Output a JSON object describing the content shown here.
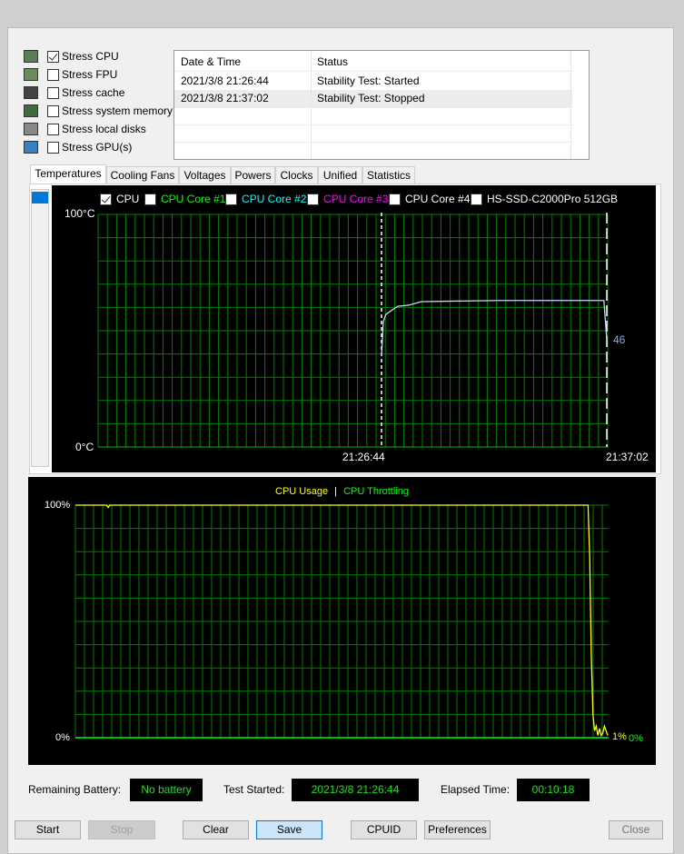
{
  "stress_options": [
    {
      "label": "Stress CPU",
      "checked": true,
      "icon": "cpu-chip-icon"
    },
    {
      "label": "Stress FPU",
      "checked": false,
      "icon": "fpu-percent-icon"
    },
    {
      "label": "Stress cache",
      "checked": false,
      "icon": "cache-chip-icon"
    },
    {
      "label": "Stress system memory",
      "checked": false,
      "icon": "memory-module-icon"
    },
    {
      "label": "Stress local disks",
      "checked": false,
      "icon": "disk-drive-icon"
    },
    {
      "label": "Stress GPU(s)",
      "checked": false,
      "icon": "gpu-monitor-icon"
    }
  ],
  "log": {
    "headers": [
      "Date & Time",
      "Status"
    ],
    "rows": [
      [
        "2021/3/8 21:26:44",
        "Stability Test: Started"
      ],
      [
        "2021/3/8 21:37:02",
        "Stability Test: Stopped"
      ]
    ]
  },
  "tabs": [
    "Temperatures",
    "Cooling Fans",
    "Voltages",
    "Powers",
    "Clocks",
    "Unified",
    "Statistics"
  ],
  "selected_tab": "Temperatures",
  "temp_chart": {
    "legend": [
      {
        "label": "CPU",
        "checked": true,
        "color": "#ffffff"
      },
      {
        "label": "CPU Core #1",
        "checked": false,
        "color": "#00ff00"
      },
      {
        "label": "CPU Core #2",
        "checked": false,
        "color": "#00ffff"
      },
      {
        "label": "CPU Core #3",
        "checked": false,
        "color": "#ff00ff"
      },
      {
        "label": "CPU Core #4",
        "checked": false,
        "color": "#ffffff"
      },
      {
        "label": "HS-SSD-C2000Pro 512GB",
        "checked": false,
        "color": "#ffffff"
      }
    ],
    "y_max_label": "100°C",
    "y_min_label": "0°C",
    "x_labels": [
      "21:26:44",
      "21:37:02"
    ],
    "current_value": "46"
  },
  "usage_chart": {
    "legend": [
      {
        "label": "CPU Usage",
        "color": "#ffff00"
      },
      {
        "label": "CPU Throttling",
        "color": "#00ff00"
      }
    ],
    "separator": "|",
    "y_max_label": "100%",
    "y_min_label": "0%",
    "usage_value": "1%",
    "throttling_value": "0%"
  },
  "chart_data": [
    {
      "type": "line",
      "title": "",
      "ylabel": "",
      "ylim": [
        0,
        100
      ],
      "grid": true,
      "series": [
        {
          "name": "CPU",
          "color": "#c8d8ff",
          "points": [
            [
              "21:26:44",
              39
            ],
            [
              "21:26:49",
              54
            ],
            [
              "21:26:56",
              57
            ],
            [
              "21:27:14",
              59
            ],
            [
              "21:27:29",
              60.5
            ],
            [
              "21:27:59",
              61
            ],
            [
              "21:28:34",
              62.5
            ],
            [
              "21:32:08",
              63
            ],
            [
              "21:36:54",
              63
            ],
            [
              "21:37:02",
              46
            ]
          ]
        }
      ],
      "markers": [
        "21:26:44",
        "21:37:02"
      ]
    },
    {
      "type": "line",
      "title": "",
      "ylim": [
        0,
        100
      ],
      "grid": true,
      "series": [
        {
          "name": "CPU Usage",
          "color": "#ffff00",
          "values": [
            100,
            100,
            100,
            100,
            100,
            100,
            100,
            100,
            100,
            100,
            100,
            100,
            100,
            100,
            100,
            100,
            100,
            100,
            100,
            100,
            99,
            100,
            100,
            100,
            100,
            100,
            100,
            100,
            100,
            100,
            100,
            100,
            100,
            100,
            100,
            100,
            100,
            100,
            100,
            100,
            100,
            100,
            100,
            100,
            100,
            100,
            100,
            100,
            100,
            100,
            100,
            100,
            100,
            100,
            100,
            100,
            100,
            100,
            100,
            100,
            100,
            100,
            100,
            100,
            100,
            100,
            100,
            100,
            100,
            100,
            100,
            100,
            100,
            100,
            100,
            100,
            100,
            100,
            100,
            100,
            100,
            100,
            100,
            100,
            100,
            100,
            100,
            100,
            100,
            100,
            100,
            100,
            100,
            100,
            100,
            100,
            100,
            100,
            100,
            100,
            100,
            100,
            100,
            100,
            100,
            100,
            100,
            100,
            100,
            100,
            100,
            100,
            100,
            100,
            100,
            100,
            100,
            100,
            100,
            100,
            100,
            100,
            100,
            100,
            100,
            100,
            100,
            100,
            100,
            100,
            100,
            100,
            100,
            100,
            100,
            100,
            100,
            100,
            100,
            100,
            100,
            100,
            100,
            100,
            100,
            100,
            100,
            100,
            100,
            100,
            100,
            100,
            100,
            100,
            100,
            100,
            100,
            100,
            100,
            100,
            100,
            100,
            100,
            100,
            100,
            100,
            100,
            100,
            100,
            100,
            100,
            100,
            100,
            100,
            100,
            100,
            100,
            100,
            100,
            100,
            100,
            100,
            100,
            100,
            100,
            100,
            100,
            100,
            100,
            100,
            100,
            100,
            100,
            100,
            100,
            100,
            100,
            100,
            100,
            100,
            100,
            100,
            100,
            100,
            100,
            100,
            100,
            100,
            100,
            100,
            100,
            100,
            100,
            100,
            100,
            100,
            100,
            100,
            100,
            100,
            100,
            100,
            100,
            100,
            100,
            100,
            100,
            100,
            100,
            100,
            100,
            100,
            100,
            100,
            100,
            100,
            100,
            100,
            100,
            100,
            100,
            100,
            100,
            100,
            100,
            100,
            100,
            100,
            100,
            100,
            100,
            100,
            100,
            100,
            100,
            100,
            100,
            100,
            100,
            100,
            100,
            100,
            100,
            100,
            100,
            100,
            100,
            100,
            100,
            100,
            100,
            100,
            100,
            100,
            100,
            100,
            100,
            100,
            100,
            100,
            100,
            100,
            100,
            100,
            100,
            100,
            100,
            100,
            100,
            100,
            100,
            100,
            100,
            100,
            100,
            100,
            100,
            100,
            100,
            100,
            100,
            100,
            100,
            100,
            100,
            100,
            100,
            100,
            100,
            100,
            100,
            100,
            100,
            100,
            78,
            35,
            10,
            3,
            5,
            1,
            4,
            1,
            2,
            5,
            3,
            1
          ]
        },
        {
          "name": "CPU Throttling",
          "color": "#00ff00",
          "values": [
            0
          ]
        }
      ]
    }
  ],
  "status": {
    "battery_label": "Remaining Battery:",
    "battery_value": "No battery",
    "started_label": "Test Started:",
    "started_value": "2021/3/8 21:26:44",
    "elapsed_label": "Elapsed Time:",
    "elapsed_value": "00:10:18"
  },
  "buttons": {
    "start": "Start",
    "stop": "Stop",
    "clear": "Clear",
    "save": "Save",
    "cpuid": "CPUID",
    "preferences": "Preferences",
    "close": "Close"
  }
}
